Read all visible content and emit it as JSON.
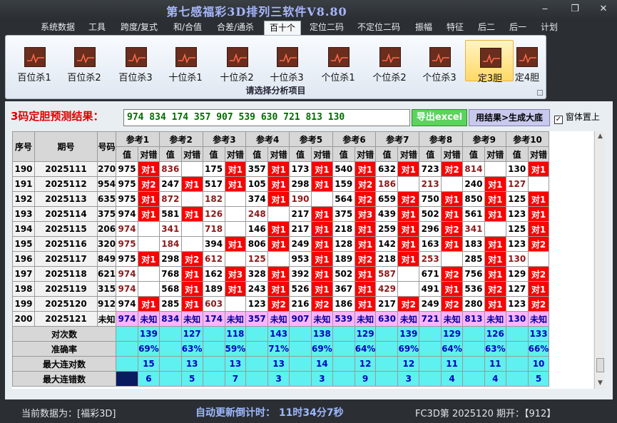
{
  "window": {
    "title": "第七感福彩3D排列三软件V8.80"
  },
  "menu": [
    "系统数据",
    "工具",
    "跨度/复式",
    "和/合值",
    "合差/通杀",
    "百十个",
    "定位二码",
    "不定位二码",
    "振幅",
    "特征",
    "后二",
    "后一",
    "计划"
  ],
  "menu_active": 5,
  "ribbon": {
    "buttons": [
      "百位杀1",
      "百位杀2",
      "百位杀3",
      "十位杀1",
      "十位杀2",
      "十位杀3",
      "个位杀1",
      "个位杀2",
      "个位杀3",
      "定3胆",
      "定4胆"
    ],
    "active": 9,
    "group_label": "请选择分析项目",
    "icon": "chart-icon"
  },
  "prediction": {
    "label": "3码定胆预测结果：",
    "value": "974 834 174 357 907 539 630 721 813 130",
    "export_label": "导出excel",
    "generate_label": "用结果>生成大底",
    "topmost_label": "窗体置上",
    "topmost_checked": true
  },
  "table": {
    "headers": {
      "seq": "序号",
      "period": "期号",
      "number": "号码",
      "refs": [
        "参考1",
        "参考2",
        "参考3",
        "参考4",
        "参考5",
        "参考6",
        "参考7",
        "参考8",
        "参考9",
        "参考10"
      ],
      "val": "值",
      "hit": "对错"
    },
    "rows": [
      {
        "seq": "190",
        "period": "2025111",
        "number": "270",
        "cells": [
          [
            "975",
            "对1"
          ],
          [
            "836",
            ""
          ],
          [
            "175",
            "对1"
          ],
          [
            "357",
            "对1"
          ],
          [
            "173",
            "对1"
          ],
          [
            "540",
            "对1"
          ],
          [
            "632",
            "对1"
          ],
          [
            "723",
            "对2"
          ],
          [
            "814",
            ""
          ],
          [
            "130",
            "对1"
          ]
        ]
      },
      {
        "seq": "191",
        "period": "2025112",
        "number": "954",
        "cells": [
          [
            "975",
            "对2"
          ],
          [
            "247",
            "对1"
          ],
          [
            "517",
            "对1"
          ],
          [
            "105",
            "对1"
          ],
          [
            "298",
            "对1"
          ],
          [
            "159",
            "对2"
          ],
          [
            "186",
            ""
          ],
          [
            "213",
            ""
          ],
          [
            "240",
            "对1"
          ],
          [
            "127",
            ""
          ]
        ]
      },
      {
        "seq": "192",
        "period": "2025113",
        "number": "635",
        "cells": [
          [
            "975",
            "对1"
          ],
          [
            "872",
            ""
          ],
          [
            "182",
            ""
          ],
          [
            "374",
            "对1"
          ],
          [
            "190",
            ""
          ],
          [
            "564",
            "对2"
          ],
          [
            "659",
            "对2"
          ],
          [
            "750",
            "对1"
          ],
          [
            "850",
            "对1"
          ],
          [
            "125",
            "对1"
          ]
        ]
      },
      {
        "seq": "193",
        "period": "2025114",
        "number": "375",
        "cells": [
          [
            "974",
            "对1"
          ],
          [
            "581",
            "对1"
          ],
          [
            "126",
            ""
          ],
          [
            "248",
            ""
          ],
          [
            "217",
            "对1"
          ],
          [
            "375",
            "对3"
          ],
          [
            "439",
            "对1"
          ],
          [
            "502",
            "对1"
          ],
          [
            "561",
            "对1"
          ],
          [
            "123",
            "对1"
          ]
        ]
      },
      {
        "seq": "194",
        "period": "2025115",
        "number": "206",
        "cells": [
          [
            "974",
            ""
          ],
          [
            "341",
            ""
          ],
          [
            "718",
            ""
          ],
          [
            "146",
            "对1"
          ],
          [
            "217",
            "对1"
          ],
          [
            "218",
            "对1"
          ],
          [
            "259",
            "对1"
          ],
          [
            "296",
            "对2"
          ],
          [
            "341",
            ""
          ],
          [
            "125",
            "对1"
          ]
        ]
      },
      {
        "seq": "195",
        "period": "2025116",
        "number": "320",
        "cells": [
          [
            "975",
            ""
          ],
          [
            "184",
            ""
          ],
          [
            "394",
            "对1"
          ],
          [
            "806",
            "对1"
          ],
          [
            "249",
            "对1"
          ],
          [
            "128",
            "对1"
          ],
          [
            "142",
            "对1"
          ],
          [
            "163",
            "对1"
          ],
          [
            "183",
            "对1"
          ],
          [
            "123",
            "对2"
          ]
        ]
      },
      {
        "seq": "196",
        "period": "2025117",
        "number": "849",
        "cells": [
          [
            "975",
            "对1"
          ],
          [
            "298",
            "对2"
          ],
          [
            "612",
            ""
          ],
          [
            "125",
            ""
          ],
          [
            "953",
            "对1"
          ],
          [
            "189",
            "对2"
          ],
          [
            "218",
            "对1"
          ],
          [
            "253",
            ""
          ],
          [
            "285",
            "对1"
          ],
          [
            "130",
            ""
          ]
        ]
      },
      {
        "seq": "197",
        "period": "2025118",
        "number": "621",
        "cells": [
          [
            "974",
            ""
          ],
          [
            "768",
            "对1"
          ],
          [
            "162",
            "对3"
          ],
          [
            "328",
            "对1"
          ],
          [
            "392",
            "对1"
          ],
          [
            "502",
            "对1"
          ],
          [
            "587",
            ""
          ],
          [
            "671",
            "对2"
          ],
          [
            "756",
            "对1"
          ],
          [
            "129",
            "对2"
          ]
        ]
      },
      {
        "seq": "198",
        "period": "2025119",
        "number": "315",
        "cells": [
          [
            "974",
            ""
          ],
          [
            "568",
            "对1"
          ],
          [
            "189",
            "对1"
          ],
          [
            "243",
            "对1"
          ],
          [
            "526",
            "对1"
          ],
          [
            "367",
            "对1"
          ],
          [
            "429",
            ""
          ],
          [
            "491",
            "对1"
          ],
          [
            "536",
            "对2"
          ],
          [
            "127",
            "对1"
          ]
        ]
      },
      {
        "seq": "199",
        "period": "2025120",
        "number": "912",
        "cells": [
          [
            "974",
            "对1"
          ],
          [
            "285",
            "对1"
          ],
          [
            "603",
            ""
          ],
          [
            "123",
            "对2"
          ],
          [
            "216",
            "对2"
          ],
          [
            "186",
            "对1"
          ],
          [
            "217",
            "对2"
          ],
          [
            "249",
            "对2"
          ],
          [
            "280",
            "对1"
          ],
          [
            "123",
            "对2"
          ]
        ]
      }
    ],
    "pending": {
      "seq": "200",
      "period": "2025121",
      "number": "未知",
      "values": [
        "974",
        "834",
        "174",
        "357",
        "907",
        "539",
        "630",
        "721",
        "813",
        "130"
      ],
      "unknown": "未知"
    },
    "stats": [
      {
        "label": "对次数",
        "values": [
          "139",
          "127",
          "118",
          "143",
          "138",
          "129",
          "139",
          "129",
          "126",
          "133"
        ]
      },
      {
        "label": "准确率",
        "values": [
          "69%",
          "63%",
          "59%",
          "71%",
          "69%",
          "64%",
          "69%",
          "64%",
          "63%",
          "66%"
        ]
      },
      {
        "label": "最大连对数",
        "values": [
          "15",
          "13",
          "13",
          "13",
          "14",
          "12",
          "12",
          "11",
          "11",
          "10"
        ]
      },
      {
        "label": "最大连错数",
        "values": [
          "6",
          "5",
          "7",
          "3",
          "3",
          "9",
          "3",
          "4",
          "4",
          "5"
        ]
      }
    ]
  },
  "status": {
    "current_data": "当前数据为：[福彩3D]",
    "countdown": "自动更新倒计时：  11时34分7秒",
    "last_draw": "FC3D第 2025120 期开：【912】"
  },
  "colors": {
    "hit": "#ff0000",
    "miss_text": "#8b1a1a",
    "pending": "#ffb3ff",
    "stats": "#5ff0f0",
    "prediction_text": "#006b00",
    "export_btn": "#5dd35d"
  }
}
